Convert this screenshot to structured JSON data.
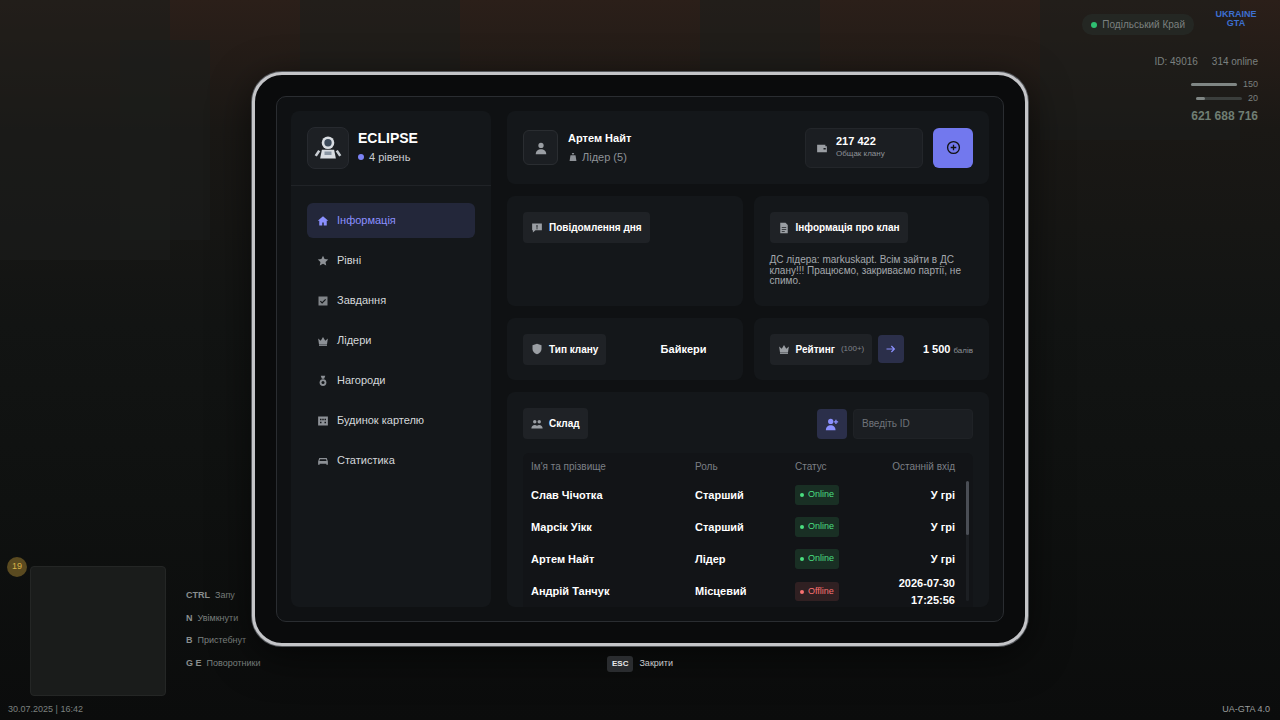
{
  "hud": {
    "location": "Подільський Край",
    "logo": "UKRAINE GTA",
    "player_id": "ID: 49016",
    "online": "314 online",
    "stats": [
      {
        "value": "150",
        "level": 1.0
      },
      {
        "value": "20",
        "level": 0.2
      }
    ],
    "money": "621 688 716",
    "level_badge": "19",
    "keybinds": [
      {
        "key": "CTRL",
        "label": "Запу"
      },
      {
        "key": "N",
        "label": "Увімкнути"
      },
      {
        "key": "B",
        "label": "Пристебнут"
      },
      {
        "key": "G  E",
        "label": "Поворотники"
      }
    ],
    "datetime": "30.07.2025 | 16:42",
    "version": "UA-GTA 4.0"
  },
  "close_hint": {
    "key": "ESC",
    "label": "Закрити"
  },
  "clan": {
    "name": "ECLIPSE",
    "level": "4 рівень"
  },
  "sidebar": {
    "items": [
      {
        "label": "Інформація",
        "selected": true
      },
      {
        "label": "Рівні",
        "selected": false
      },
      {
        "label": "Завдання",
        "selected": false
      },
      {
        "label": "Лідери",
        "selected": false
      },
      {
        "label": "Нагороди",
        "selected": false
      },
      {
        "label": "Будинок картелю",
        "selected": false
      },
      {
        "label": "Статистика",
        "selected": false
      }
    ]
  },
  "member": {
    "name": "Артем Найт",
    "rank": "Лідер (5)"
  },
  "treasury": {
    "amount": "217 422",
    "label": "Общак клану"
  },
  "motd": {
    "title": "Повідомлення дня"
  },
  "clan_info": {
    "title": "Інформація про клан",
    "text": "ДС лідера: markuskapt. Всім зайти в ДС клану!!! Працюємо, закриваємо партії, не спимо."
  },
  "clan_type": {
    "label": "Тип клану",
    "value": "Байкери"
  },
  "rating": {
    "label": "Рейтинг",
    "hint": "(100+)",
    "value": "1 500",
    "unit": "балів"
  },
  "roster": {
    "title": "Склад",
    "search": {
      "placeholder": "Введіть ID"
    },
    "columns": [
      "Ім'я та прізвище",
      "Роль",
      "Статус",
      "Останній вхід"
    ],
    "rows": [
      {
        "name": "Слав Чічотка",
        "role": "Старший",
        "status": "Online",
        "color": "#4ade80",
        "last_seen": "У грі"
      },
      {
        "name": "Марсік Уікк",
        "role": "Старший",
        "status": "Online",
        "color": "#4ade80",
        "last_seen": "У грі"
      },
      {
        "name": "Артем Найт",
        "role": "Лідер",
        "status": "Online",
        "color": "#4ade80",
        "last_seen": "У грі"
      },
      {
        "name": "Андрій Танчук",
        "role": "Місцевий",
        "status": "Offline",
        "color": "#f87171",
        "last_seen": "2026-07-30 17:25:56"
      }
    ],
    "scrollbar": {
      "level": 0.45
    }
  }
}
